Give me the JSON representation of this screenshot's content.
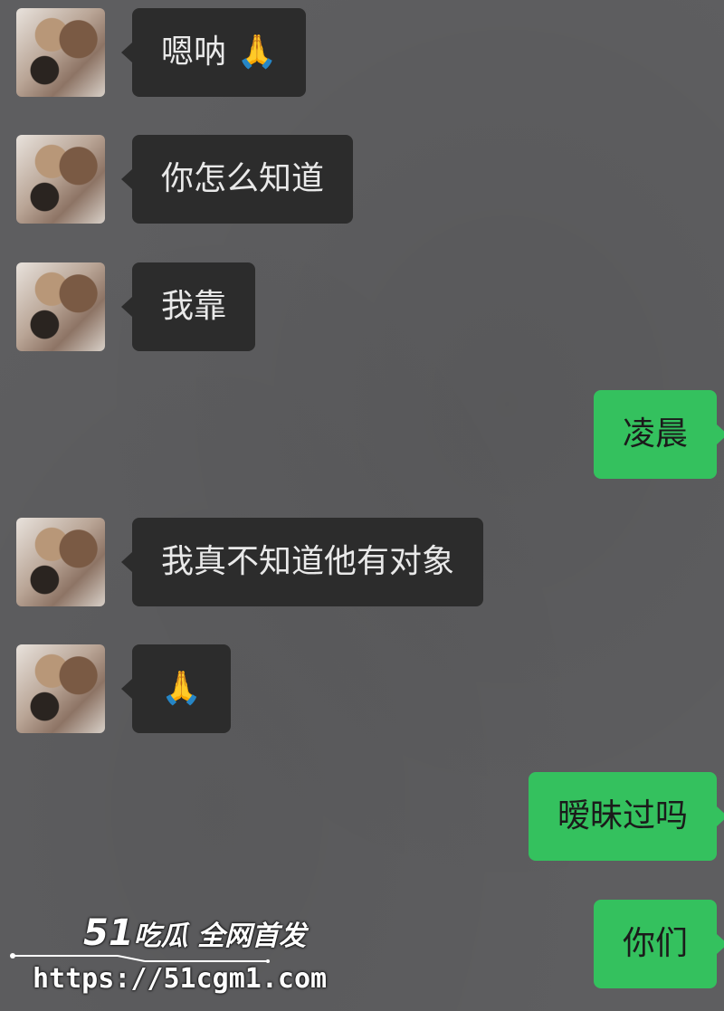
{
  "messages": [
    {
      "side": "in",
      "text": "嗯呐 🙏"
    },
    {
      "side": "in",
      "text": "你怎么知道"
    },
    {
      "side": "in",
      "text": "我靠"
    },
    {
      "side": "out",
      "text": "凌晨"
    },
    {
      "side": "in",
      "text": "我真不知道他有对象"
    },
    {
      "side": "in",
      "text": "🙏"
    },
    {
      "side": "out",
      "text": "暧昧过吗"
    },
    {
      "side": "out",
      "text": "你们"
    }
  ],
  "watermark": {
    "brand_number": "51",
    "brand_text": "吃瓜 全网首发",
    "url": "https://51cgm1.com"
  },
  "colors": {
    "background": "#5e5e60",
    "incoming_bubble": "#2c2c2c",
    "outgoing_bubble": "#34c15e"
  }
}
